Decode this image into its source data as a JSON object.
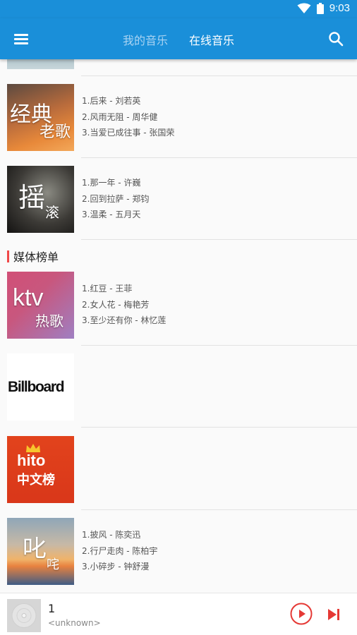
{
  "status": {
    "time": "9:03"
  },
  "header": {
    "tabs": [
      {
        "label": "我的音乐",
        "active": false
      },
      {
        "label": "在线音乐",
        "active": true
      }
    ]
  },
  "charts": [
    {
      "cover": {
        "line1": "经典",
        "line2": "老歌"
      },
      "tracks": [
        "1.后来 - 刘若英",
        "2.风雨无阻 - 周华健",
        "3.当爱已成往事 - 张国荣"
      ]
    },
    {
      "cover": {
        "line1": "摇",
        "line2": "滚"
      },
      "tracks": [
        "1.那一年 - 许巍",
        "2.回到拉萨 - 郑钧",
        "3.温柔 - 五月天"
      ]
    }
  ],
  "media_section": {
    "title": "媒体榜单"
  },
  "media_charts": [
    {
      "cover": {
        "line1": "ktv",
        "line2": "热歌"
      },
      "tracks": [
        "1.红豆 - 王菲",
        "2.女人花 - 梅艳芳",
        "3.至少还有你 - 林忆莲"
      ]
    },
    {
      "cover": {
        "line1": "Billboard"
      },
      "tracks": []
    },
    {
      "cover": {
        "line1": "hito",
        "line2": "中文榜"
      },
      "tracks": []
    },
    {
      "cover": {
        "line1": "叱",
        "line2": "咤"
      },
      "tracks": [
        "1.披风 - 陈奕迅",
        "2.行尸走肉 - 陈柏宇",
        "3.小碎步 - 钟舒漫"
      ]
    }
  ],
  "player": {
    "title": "1",
    "artist": "<unknown>"
  },
  "colors": {
    "primary": "#1a8fd9",
    "accent": "#f04848"
  }
}
